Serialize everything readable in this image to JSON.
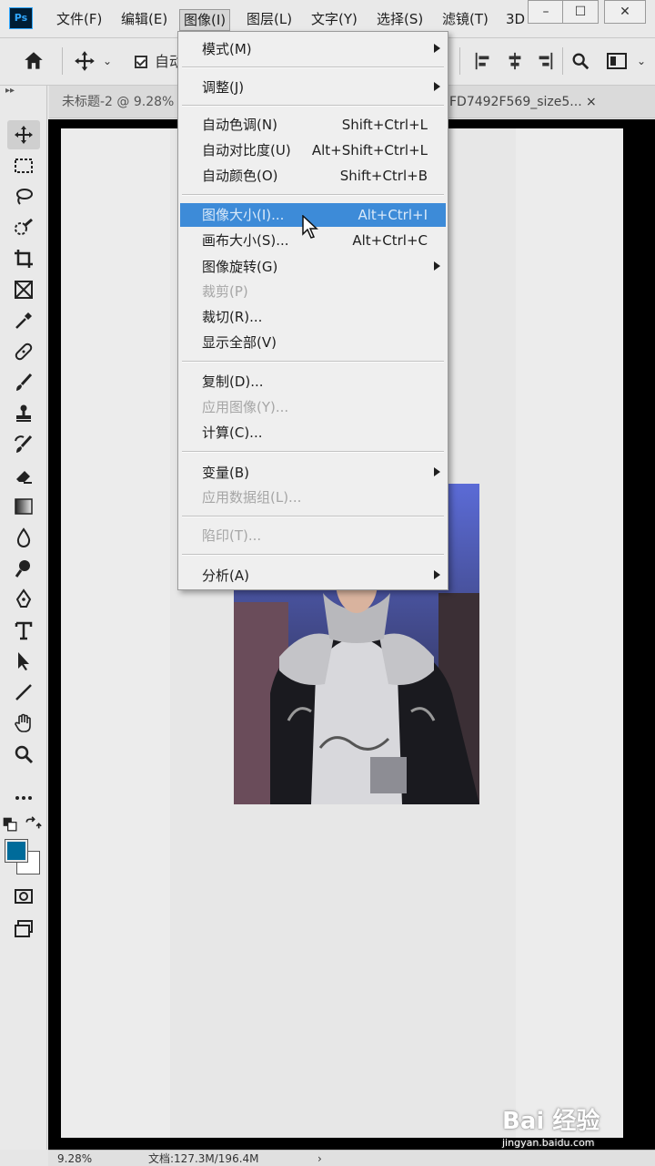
{
  "app": {
    "logo_text": "Ps"
  },
  "menubar": {
    "items": [
      "文件(F)",
      "编辑(E)",
      "图像(I)",
      "图层(L)",
      "文字(Y)",
      "选择(S)",
      "滤镜(T)",
      "3D"
    ],
    "active_item": "图像(I)",
    "window_controls": [
      "–",
      "☐",
      "✕"
    ]
  },
  "options_bar": {
    "auto_select_label": "自动"
  },
  "tabs": [
    {
      "label": "未标题-2 @ 9.28%"
    },
    {
      "label": "FD7492F569_size5..."
    }
  ],
  "tab_close": "×",
  "tools": [
    "move",
    "rect-marquee",
    "lasso",
    "quick-select",
    "crop",
    "frame",
    "eyedropper",
    "healing",
    "brush",
    "clone-stamp",
    "history-brush",
    "eraser",
    "gradient",
    "blur",
    "dodge",
    "pen",
    "type",
    "path-select",
    "line",
    "hand",
    "zoom",
    "more"
  ],
  "colors": {
    "foreground": "#006b9a",
    "background": "#ffffff",
    "highlight": "#3d8bd8"
  },
  "image_menu": {
    "items": [
      {
        "label": "模式(M)",
        "shortcut": "",
        "submenu": true,
        "disabled": false
      },
      {
        "label": "调整(J)",
        "shortcut": "",
        "submenu": true,
        "disabled": false
      },
      {
        "label": "自动色调(N)",
        "shortcut": "Shift+Ctrl+L",
        "submenu": false,
        "disabled": false
      },
      {
        "label": "自动对比度(U)",
        "shortcut": "Alt+Shift+Ctrl+L",
        "submenu": false,
        "disabled": false
      },
      {
        "label": "自动颜色(O)",
        "shortcut": "Shift+Ctrl+B",
        "submenu": false,
        "disabled": false
      },
      {
        "label": "图像大小(I)...",
        "shortcut": "Alt+Ctrl+I",
        "submenu": false,
        "disabled": false,
        "highlighted": true
      },
      {
        "label": "画布大小(S)...",
        "shortcut": "Alt+Ctrl+C",
        "submenu": false,
        "disabled": false
      },
      {
        "label": "图像旋转(G)",
        "shortcut": "",
        "submenu": true,
        "disabled": false
      },
      {
        "label": "裁剪(P)",
        "shortcut": "",
        "submenu": false,
        "disabled": true
      },
      {
        "label": "裁切(R)...",
        "shortcut": "",
        "submenu": false,
        "disabled": false
      },
      {
        "label": "显示全部(V)",
        "shortcut": "",
        "submenu": false,
        "disabled": false
      },
      {
        "label": "复制(D)...",
        "shortcut": "",
        "submenu": false,
        "disabled": false
      },
      {
        "label": "应用图像(Y)...",
        "shortcut": "",
        "submenu": false,
        "disabled": true
      },
      {
        "label": "计算(C)...",
        "shortcut": "",
        "submenu": false,
        "disabled": false
      },
      {
        "label": "变量(B)",
        "shortcut": "",
        "submenu": true,
        "disabled": false
      },
      {
        "label": "应用数据组(L)...",
        "shortcut": "",
        "submenu": false,
        "disabled": true
      },
      {
        "label": "陷印(T)...",
        "shortcut": "",
        "submenu": false,
        "disabled": true
      },
      {
        "label": "分析(A)",
        "shortcut": "",
        "submenu": true,
        "disabled": false
      }
    ]
  },
  "status": {
    "zoom": "9.28%",
    "doc_info": "文档:127.3M/196.4M",
    "arrow": "›"
  },
  "watermark": {
    "brand": "Bai 经验",
    "url": "jingyan.baidu.com"
  }
}
